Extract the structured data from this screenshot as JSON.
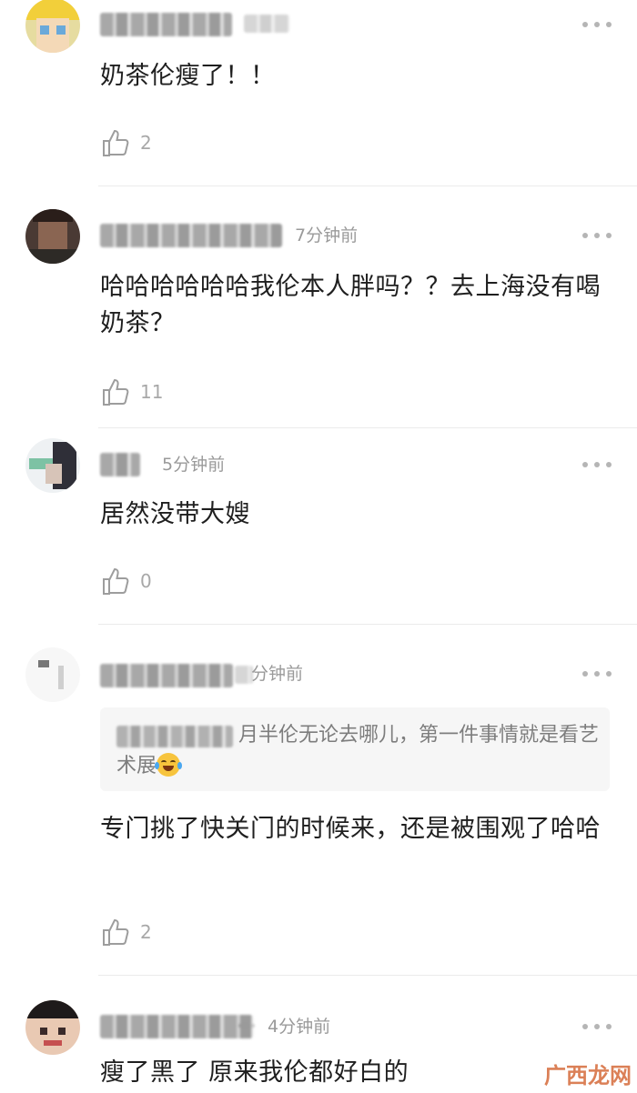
{
  "comments": [
    {
      "time": "",
      "text": "奶茶伦瘦了！！",
      "likes": "2"
    },
    {
      "time": "7分钟前",
      "text": "哈哈哈哈哈哈我伦本人胖吗？？去上海没有喝奶茶？",
      "likes": "11"
    },
    {
      "time": "5分钟前",
      "text": "居然没带大嫂",
      "likes": "0"
    },
    {
      "time": "分钟前",
      "quote": "月半伦无论去哪儿，第一件事情就是看艺术展",
      "quote_emoji": "laughing-with-tears-icon",
      "text": "专门挑了快关门的时候来，还是被围观了哈哈",
      "likes": "2"
    },
    {
      "time": "4分钟前",
      "text": "瘦了黑了 原来我伦都好白的",
      "likes": ""
    }
  ],
  "icons": {
    "like": "thumbs-up-icon",
    "more": "more-dots-icon"
  },
  "colors": {
    "secondary_text": "#9a9a9a",
    "main_text": "#1f1f1f",
    "divider": "#ebebeb",
    "quote_bg": "#f6f6f6"
  },
  "watermark": "广西龙网"
}
